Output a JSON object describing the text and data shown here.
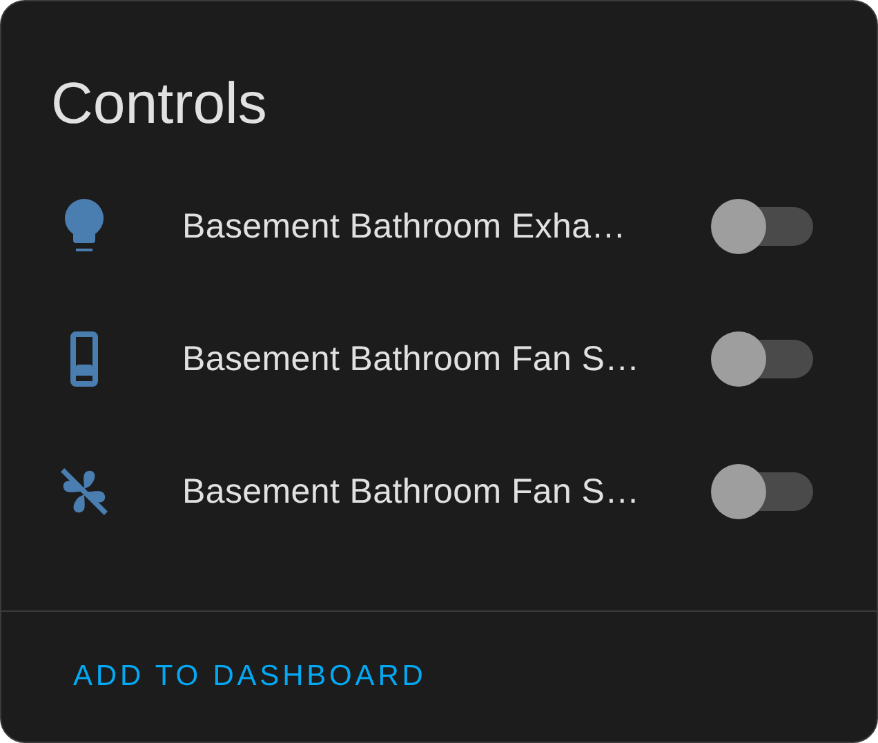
{
  "title": "Controls",
  "entities": [
    {
      "kind": "bulb",
      "name": "Basement Bathroom Exha…",
      "on": false
    },
    {
      "kind": "switch",
      "name": "Basement Bathroom Fan S…",
      "on": false
    },
    {
      "kind": "fan-off",
      "name": "Basement Bathroom Fan S…",
      "on": false
    }
  ],
  "action": "ADD TO DASHBOARD"
}
